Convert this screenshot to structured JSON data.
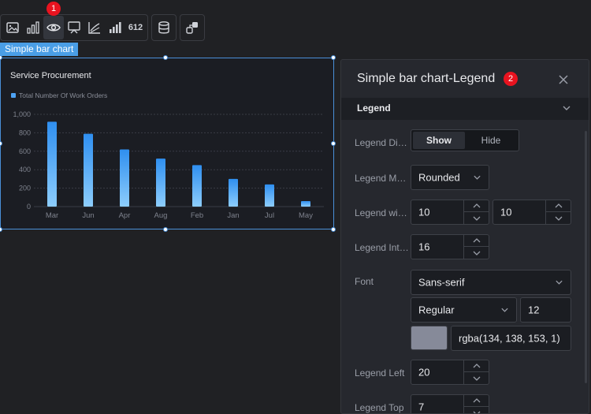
{
  "toolbar": {
    "groups": [
      [
        "image-icon",
        "bar-chart-icon",
        "eye-icon",
        "carousel-icon",
        "line-chart-icon",
        "histogram-icon",
        "number-icon"
      ],
      [
        "database-icon"
      ],
      [
        "link-icon"
      ]
    ],
    "number_label": "612",
    "active_index": 2,
    "badge_1": "1"
  },
  "selection_label": "Simple bar chart",
  "chart_data": {
    "type": "bar",
    "title": "Service Procurement",
    "categories": [
      "Mar",
      "Jun",
      "Apr",
      "Aug",
      "Feb",
      "Jan",
      "Jul",
      "May"
    ],
    "series": [
      {
        "name": "Total Number Of Work Orders",
        "values": [
          920,
          790,
          620,
          520,
          450,
          300,
          240,
          60
        ]
      }
    ],
    "y_ticks": [
      "0",
      "200",
      "400",
      "600",
      "800",
      "1,000"
    ],
    "ylim": [
      0,
      1000
    ],
    "grid": true,
    "legend_position": "top-left",
    "colors": {
      "bar_top": "#2f8ff0",
      "bar_bottom": "#8dcdfc",
      "grid": "#3a3d46",
      "tick_text": "#7e828d"
    }
  },
  "panel": {
    "title": "Simple bar chart-Legend",
    "badge_2": "2",
    "close_icon": "close-icon",
    "section_label": "Legend",
    "rows": {
      "display": {
        "label": "Legend Display",
        "options": [
          "Show",
          "Hide"
        ],
        "selected": "Show"
      },
      "mark": {
        "label": "Legend Mark",
        "value": "Rounded"
      },
      "width": {
        "label": "Legend width/height",
        "value1": "10",
        "value2": "10"
      },
      "interval": {
        "label": "Legend Interval",
        "value": "16"
      },
      "font": {
        "label": "Font",
        "family": "Sans-serif",
        "weight": "Regular",
        "size": "12",
        "color": "rgba(134, 138, 153, 1)",
        "swatch": "#868a99"
      },
      "left": {
        "label": "Legend Left",
        "value": "20"
      },
      "top": {
        "label": "Legend Top",
        "value": "7"
      }
    }
  }
}
